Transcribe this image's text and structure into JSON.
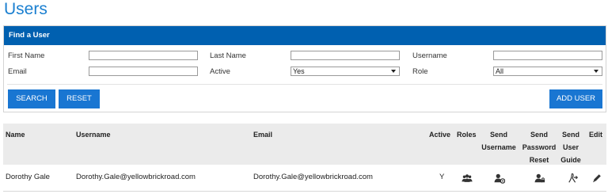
{
  "page": {
    "title": "Users"
  },
  "search_panel": {
    "header": "Find a User",
    "first_name": {
      "label": "First Name",
      "value": ""
    },
    "last_name": {
      "label": "Last Name",
      "value": ""
    },
    "username": {
      "label": "Username",
      "value": ""
    },
    "email": {
      "label": "Email",
      "value": ""
    },
    "active": {
      "label": "Active",
      "selected": "Yes"
    },
    "role": {
      "label": "Role",
      "selected": "All"
    },
    "buttons": {
      "search": "SEARCH",
      "reset": "RESET",
      "add_user": "ADD USER"
    }
  },
  "table": {
    "headers": {
      "name": "Name",
      "username": "Username",
      "email": "Email",
      "active": "Active",
      "roles": "Roles",
      "send_username": [
        "Send",
        "Username"
      ],
      "send_password_reset": [
        "Send",
        "Password",
        "Reset"
      ],
      "send_user_guide": [
        "Send",
        "User",
        "Guide"
      ],
      "edit": "Edit"
    },
    "rows": [
      {
        "name": "Dorothy Gale",
        "username": "Dorothy.Gale@yellowbrickroad.com",
        "email": "Dorothy.Gale@yellowbrickroad.com",
        "active": "Y",
        "icons": [
          "roles-icon",
          "send-username-icon",
          "send-password-reset-icon",
          "send-user-guide-icon",
          "edit-icon"
        ]
      }
    ]
  },
  "colors": {
    "title": "#1a7fd0",
    "panel_header": "#0060b0",
    "button": "#1976d2",
    "table_header": "#ebebeb"
  }
}
